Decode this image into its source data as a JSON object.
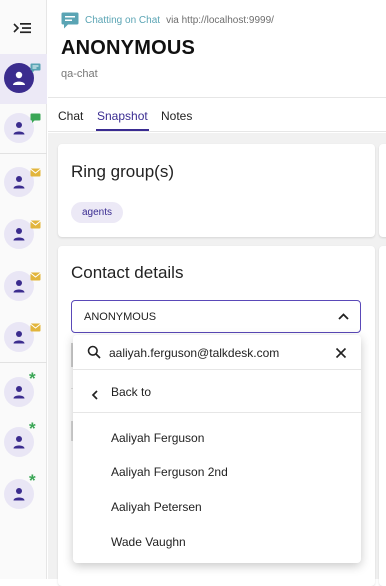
{
  "header": {
    "channel": "Chatting on Chat",
    "via": "via http://localhost:9999/",
    "title": "ANONYMOUS",
    "subtitle": "qa-chat"
  },
  "tabs": [
    {
      "label": "Chat",
      "active": false
    },
    {
      "label": "Snapshot",
      "active": true
    },
    {
      "label": "Notes",
      "active": false
    }
  ],
  "ring_group": {
    "title": "Ring group(s)",
    "chips": [
      "agents"
    ]
  },
  "contact_details": {
    "title": "Contact details",
    "selected_value": "ANONYMOUS"
  },
  "dropdown": {
    "search_value": "aaliyah.ferguson@talkdesk.com",
    "back_label": "Back to",
    "options": [
      "Aaliyah Ferguson",
      "Aaliyah Ferguson 2nd",
      "Aaliyah Petersen",
      "Wade Vaughn"
    ]
  },
  "rail": {
    "items": [
      {
        "icon": "user-icon",
        "badge": "chat-bubble-icon",
        "active": true
      },
      {
        "icon": "user-icon",
        "badge": "green-flag-icon",
        "active": false
      },
      {
        "icon": "user-icon",
        "badge": "envelope-icon",
        "active": false
      },
      {
        "icon": "user-icon",
        "badge": "envelope-icon",
        "active": false
      },
      {
        "icon": "user-icon",
        "badge": "envelope-icon",
        "active": false
      },
      {
        "icon": "user-icon",
        "badge": "envelope-icon",
        "active": false
      },
      {
        "icon": "user-icon",
        "badge": "asterisk-icon",
        "active": false
      },
      {
        "icon": "user-icon",
        "badge": "asterisk-icon",
        "active": false
      },
      {
        "icon": "user-icon",
        "badge": "asterisk-icon",
        "active": false
      }
    ]
  },
  "colors": {
    "accent": "#3a2c91",
    "channel": "#5aa4b4",
    "envelope": "#e2b53c",
    "green": "#3aa655"
  }
}
